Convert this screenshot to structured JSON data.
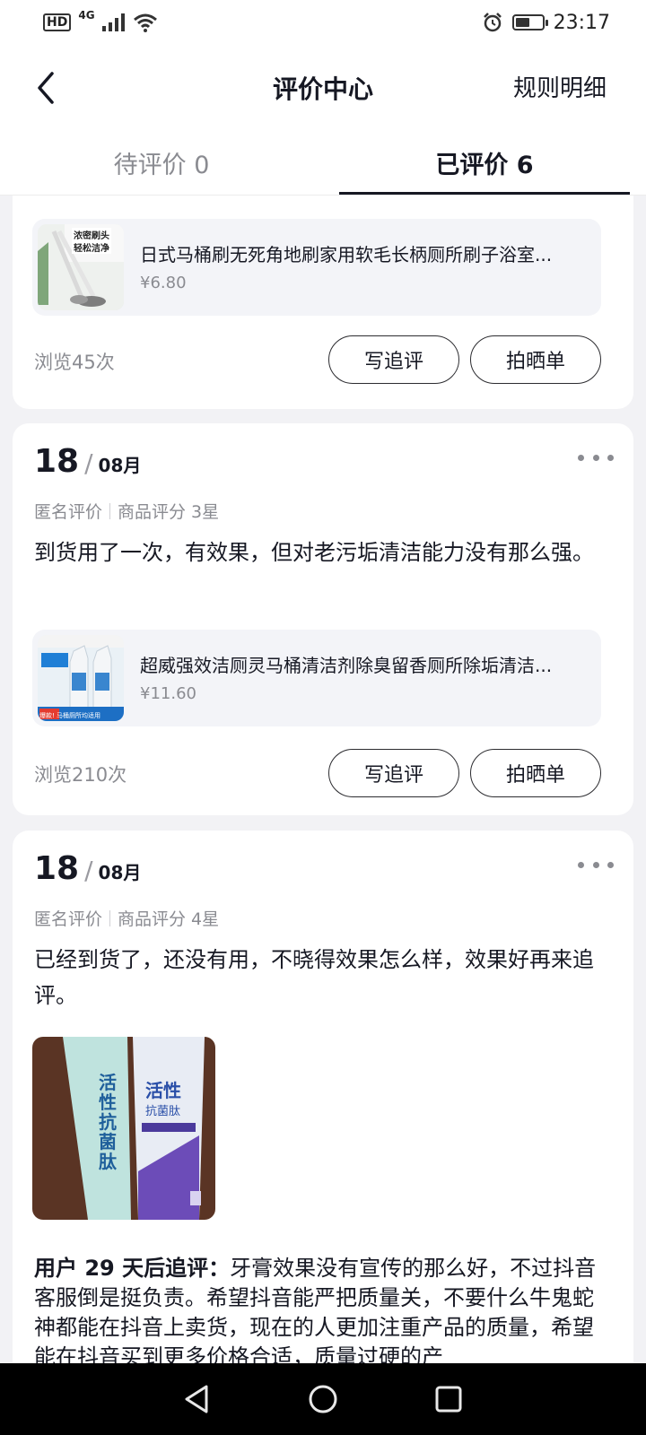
{
  "status_bar": {
    "signal_label": "HD",
    "network": "4G",
    "time": "23:17",
    "battery_percent": 55
  },
  "header": {
    "title": "评价中心",
    "rules_label": "规则明细"
  },
  "tabs": [
    {
      "label": "待评价 0",
      "active": false
    },
    {
      "label": "已评价 6",
      "active": true
    }
  ],
  "reviews": [
    {
      "product": {
        "name": "日式马桶刷无死角地刷家用软毛长柄厕所刷子浴室...",
        "price": "¥6.80",
        "thumb_caption_1": "浓密刷头",
        "thumb_caption_2": "轻松洁净"
      },
      "views": "浏览45次",
      "followup_button": "写追评",
      "photo_button": "拍晒单"
    },
    {
      "date_day": "18",
      "date_sep": "/",
      "date_month": "08月",
      "anonymous": "匿名评价",
      "rating": "商品评分 3星",
      "text": "到货用了一次，有效果，但对老污垢清洁能力没有那么强。",
      "product": {
        "name": "超威强效洁厕灵马桶清洁剂除臭留香厕所除垢清洁...",
        "price": "¥11.60",
        "thumb_caption": "爆款! 马桶厕所均适用"
      },
      "views": "浏览210次",
      "followup_button": "写追评",
      "photo_button": "拍晒单"
    },
    {
      "date_day": "18",
      "date_sep": "/",
      "date_month": "08月",
      "anonymous": "匿名评价",
      "rating": "商品评分 4星",
      "text": "已经到货了，还没有用，不晓得效果怎么样，效果好再来追评。",
      "photo_text_1": "活性抗菌肽",
      "photo_text_2": "活性",
      "photo_text_3": "抗菌肽",
      "followup_prefix": "用户 29 天后追评：",
      "followup_text": "牙膏效果没有宣传的那么好，不过抖音客服倒是挺负责。希望抖音能严把质量关，不要什么牛鬼蛇神都能在抖音上卖货，现在的人更加注重产品的质量，希望能在抖音买到更多价格合适，质量过硬的产"
    }
  ],
  "nav": {
    "back_icon": "triangle-back-icon",
    "home_icon": "circle-home-icon",
    "recents_icon": "square-recents-icon"
  }
}
